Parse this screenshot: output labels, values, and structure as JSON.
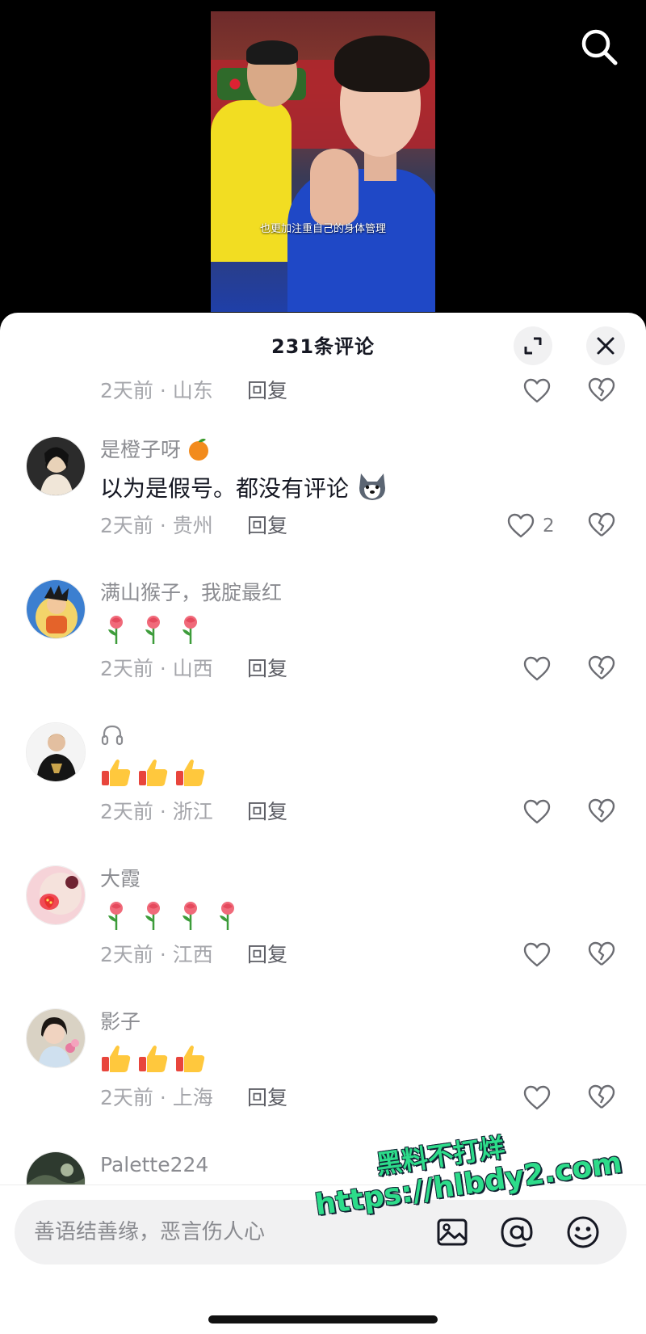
{
  "video": {
    "caption": "也更加注重自己的身体管理"
  },
  "sheet": {
    "title": "231条评论"
  },
  "top_meta": {
    "meta": "2天前 · 山东",
    "reply": "回复"
  },
  "comments": [
    {
      "username": "是橙子呀",
      "text": "以为是假号。都没有评论",
      "meta": "2天前 · 贵州",
      "reply": "回复",
      "likes": "2"
    },
    {
      "username": "满山猴子，我腚最红",
      "meta": "2天前 · 山西",
      "reply": "回复"
    },
    {
      "username": "",
      "meta": "2天前 · 浙江",
      "reply": "回复"
    },
    {
      "username": "大霞",
      "meta": "2天前 · 江西",
      "reply": "回复"
    },
    {
      "username": "影子",
      "meta": "2天前 · 上海",
      "reply": "回复"
    },
    {
      "username": "Palette224"
    }
  ],
  "input": {
    "placeholder": "善语结善缘，恶言伤人心"
  },
  "watermark": {
    "line1": "黑料不打烊",
    "line2": "https://hlbdy2.com"
  }
}
